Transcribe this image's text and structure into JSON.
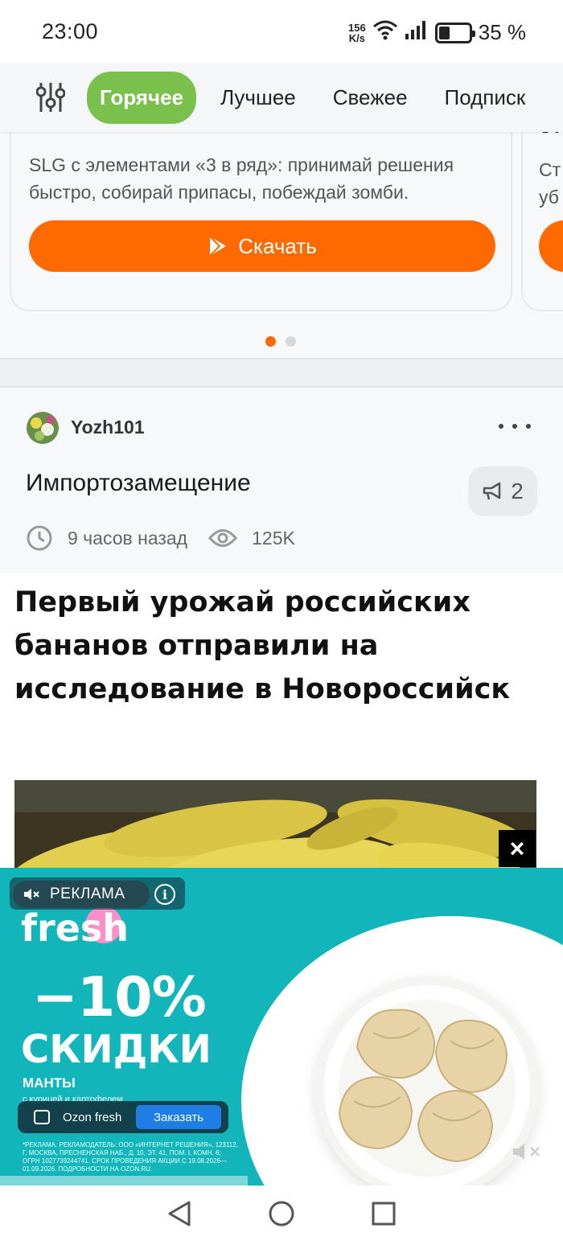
{
  "status_bar": {
    "time": "23:00",
    "net_speed_value": "156",
    "net_speed_unit": "K/s",
    "battery_percent": "35 %",
    "battery_level": 0.35
  },
  "tabs": [
    {
      "label": "Горячее",
      "active": true
    },
    {
      "label": "Лучшее",
      "active": false
    },
    {
      "label": "Свежее",
      "active": false
    },
    {
      "label": "Подписк",
      "active": false
    }
  ],
  "promo": {
    "description": "SLG с элементами «3 в ряд»: принимай решения быстро, собирай припасы, побеждай зомби.",
    "button_label": "Скачать",
    "peek_title": "ст",
    "peek_line1": "Ст",
    "peek_line2": "уб",
    "dots_total": 2,
    "dots_active": 1,
    "accent_color": "#ff6a00"
  },
  "post": {
    "author": "Yozh101",
    "title": "Импортозамещение",
    "comments_count": "2",
    "time_ago": "9 часов назад",
    "views": "125K",
    "headline": "Первый урожай российских бананов отправили на исследование в Новороссийск"
  },
  "ad": {
    "close_label": "×",
    "label": "РЕКЛАМА",
    "info_glyph": "i",
    "brand": "fresh",
    "discount": "−10%",
    "discount_word": "СКИДКИ",
    "product": "МАНТЫ",
    "product_sub": "с курицей и картофелем",
    "cta_name": "Ozon fresh",
    "cta_button": "Заказать",
    "legal": "*РЕКЛАМА. РЕКЛАМОДАТЕЛЬ: ООО «ИНТЕРНЕТ РЕШЕНИЯ», 123112, Г. МОСКВА, ПРЕСНЕНСКАЯ НАБ., Д. 10, ЭТ. 41, ПОМ. I, КОМН. 6; ОГРН 1027739244741. СРОК ПРОВЕДЕНИЯ АКЦИИ С 19.08.2026—01.09.2026. ПОДРОБНОСТИ НА OZON.RU.",
    "bg_color": "#12b5b9"
  }
}
